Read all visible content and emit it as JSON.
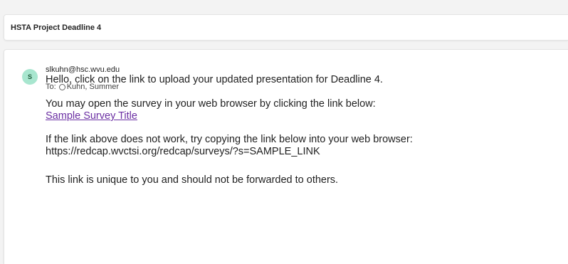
{
  "subject": "HSTA Project Deadline 4",
  "message": {
    "avatar_initial": "S",
    "sender": "slkuhn@hsc.wvu.edu",
    "to_label": "To:",
    "to_name": "Kuhn, Summer",
    "body": {
      "line1": "Hello, click on the link to upload your updated presentation for Deadline 4.",
      "line2": "You may open the survey in your web browser by clicking the link below:",
      "link_text": "Sample Survey Title",
      "line3": "If the link above does not work, try copying the link below into your web browser:",
      "url": "https://redcap.wvctsi.org/redcap/surveys/?s=SAMPLE_LINK",
      "line4": "This link is unique to you and should not be forwarded to others."
    }
  },
  "colors": {
    "avatar_bg": "#a8e6cf",
    "link": "#6b2fa3"
  },
  "icons": {
    "presence": "presence-circle-icon"
  }
}
